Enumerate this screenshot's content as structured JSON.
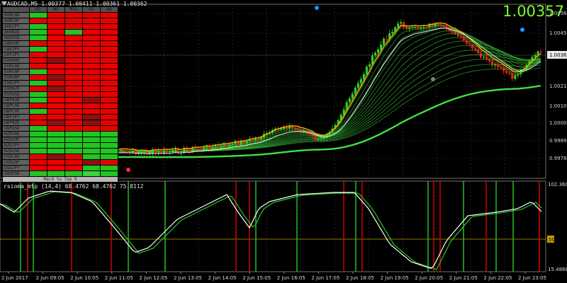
{
  "window": {
    "title": "AUDCAD,M5  1.00377 1.00411 1.00361 1.00362",
    "big_price": "1.00357"
  },
  "heatmap": {
    "headers": [
      "M1",
      "M5",
      "M15",
      "H1",
      "H4"
    ],
    "pairs": [
      "AUDCAD",
      "AUDCHF",
      "AUDJPY",
      "AUDNZD",
      "AUDUSD",
      "CADCHF",
      "CADJPY",
      "CHFJPY",
      "EURAUD",
      "EURCAD",
      "EURCHF",
      "EURGBP",
      "EURJPY",
      "EURNZD",
      "EURUSD",
      "GBPAUD",
      "GBPCAD",
      "GBPCHF",
      "GBPJPY",
      "GBPNZD",
      "GBPUSD",
      "NZDCAD",
      "NZDCHF",
      "NZDJPY",
      "NZDUSD",
      "USDCAD",
      "USDCHF",
      "USDJPY",
      "XAUUSD"
    ],
    "footer": "Macd tu Top 9",
    "colors": {
      "R": "#e80000",
      "r": "#8c1010",
      "G": "#22c422",
      "g": "#1a7a1a",
      "L": "#3cd23c"
    },
    "rows": [
      "GRRRR",
      "RRRRR",
      "GRRRR",
      "GRGRR",
      "GRRRR",
      "RRRRR",
      "GRRRR",
      "RRRRR",
      "RrRRR",
      "RRRRR",
      "GRRRR",
      "RrRRR",
      "GRRRR",
      "RrRRR",
      "GRRRR",
      "GRRrR",
      "RRRRR",
      "GRRRR",
      "RRRrR",
      "RrRrR",
      "GRRRR",
      "GGGGG",
      "GGGGG",
      "GGGGG",
      "GGGGG",
      "RrRGG",
      "RRRrR",
      "RRRGG",
      "GGGLG"
    ]
  },
  "price_axis": {
    "labels": [
      "1.00565",
      "1.00455",
      "1.00362",
      "1.00215",
      "1.00105",
      "1.00000",
      "0.99895",
      "0.99785"
    ],
    "current": "1.00362"
  },
  "indicator": {
    "title": "rsioma_mtp  (14,4) 68.4762 68.4762 75.8112",
    "axis_top": "102.3604",
    "axis_mid": "50",
    "axis_bottom": "15.4868"
  },
  "time_axis": [
    "2 Jun 2017",
    "2 Jun 09:05",
    "2 Jun 10:05",
    "2 Jun 11:05",
    "2 Jun 12:05",
    "2 Jun 13:05",
    "2 Jun 14:05",
    "2 Jun 15:05",
    "2 Jun 16:05",
    "2 Jun 17:05",
    "2 Jun 18:05",
    "2 Jun 19:05",
    "2 Jun 20:05",
    "2 Jun 21:05",
    "2 Jun 22:05",
    "2 Jun 23:05"
  ],
  "colors": {
    "bull": "#2fd22f",
    "bear": "#ff1a1a",
    "ribbon": "#3ad23a",
    "fast_ma": "#ffb000",
    "grid": "#3a3a3a",
    "rsi_main": "#ffffff",
    "rsi_signal": "#22cc22",
    "level": "#c8a000",
    "vline_up": "#22cc22",
    "vline_down": "#e00000",
    "marker": "#0aa0ff"
  }
}
